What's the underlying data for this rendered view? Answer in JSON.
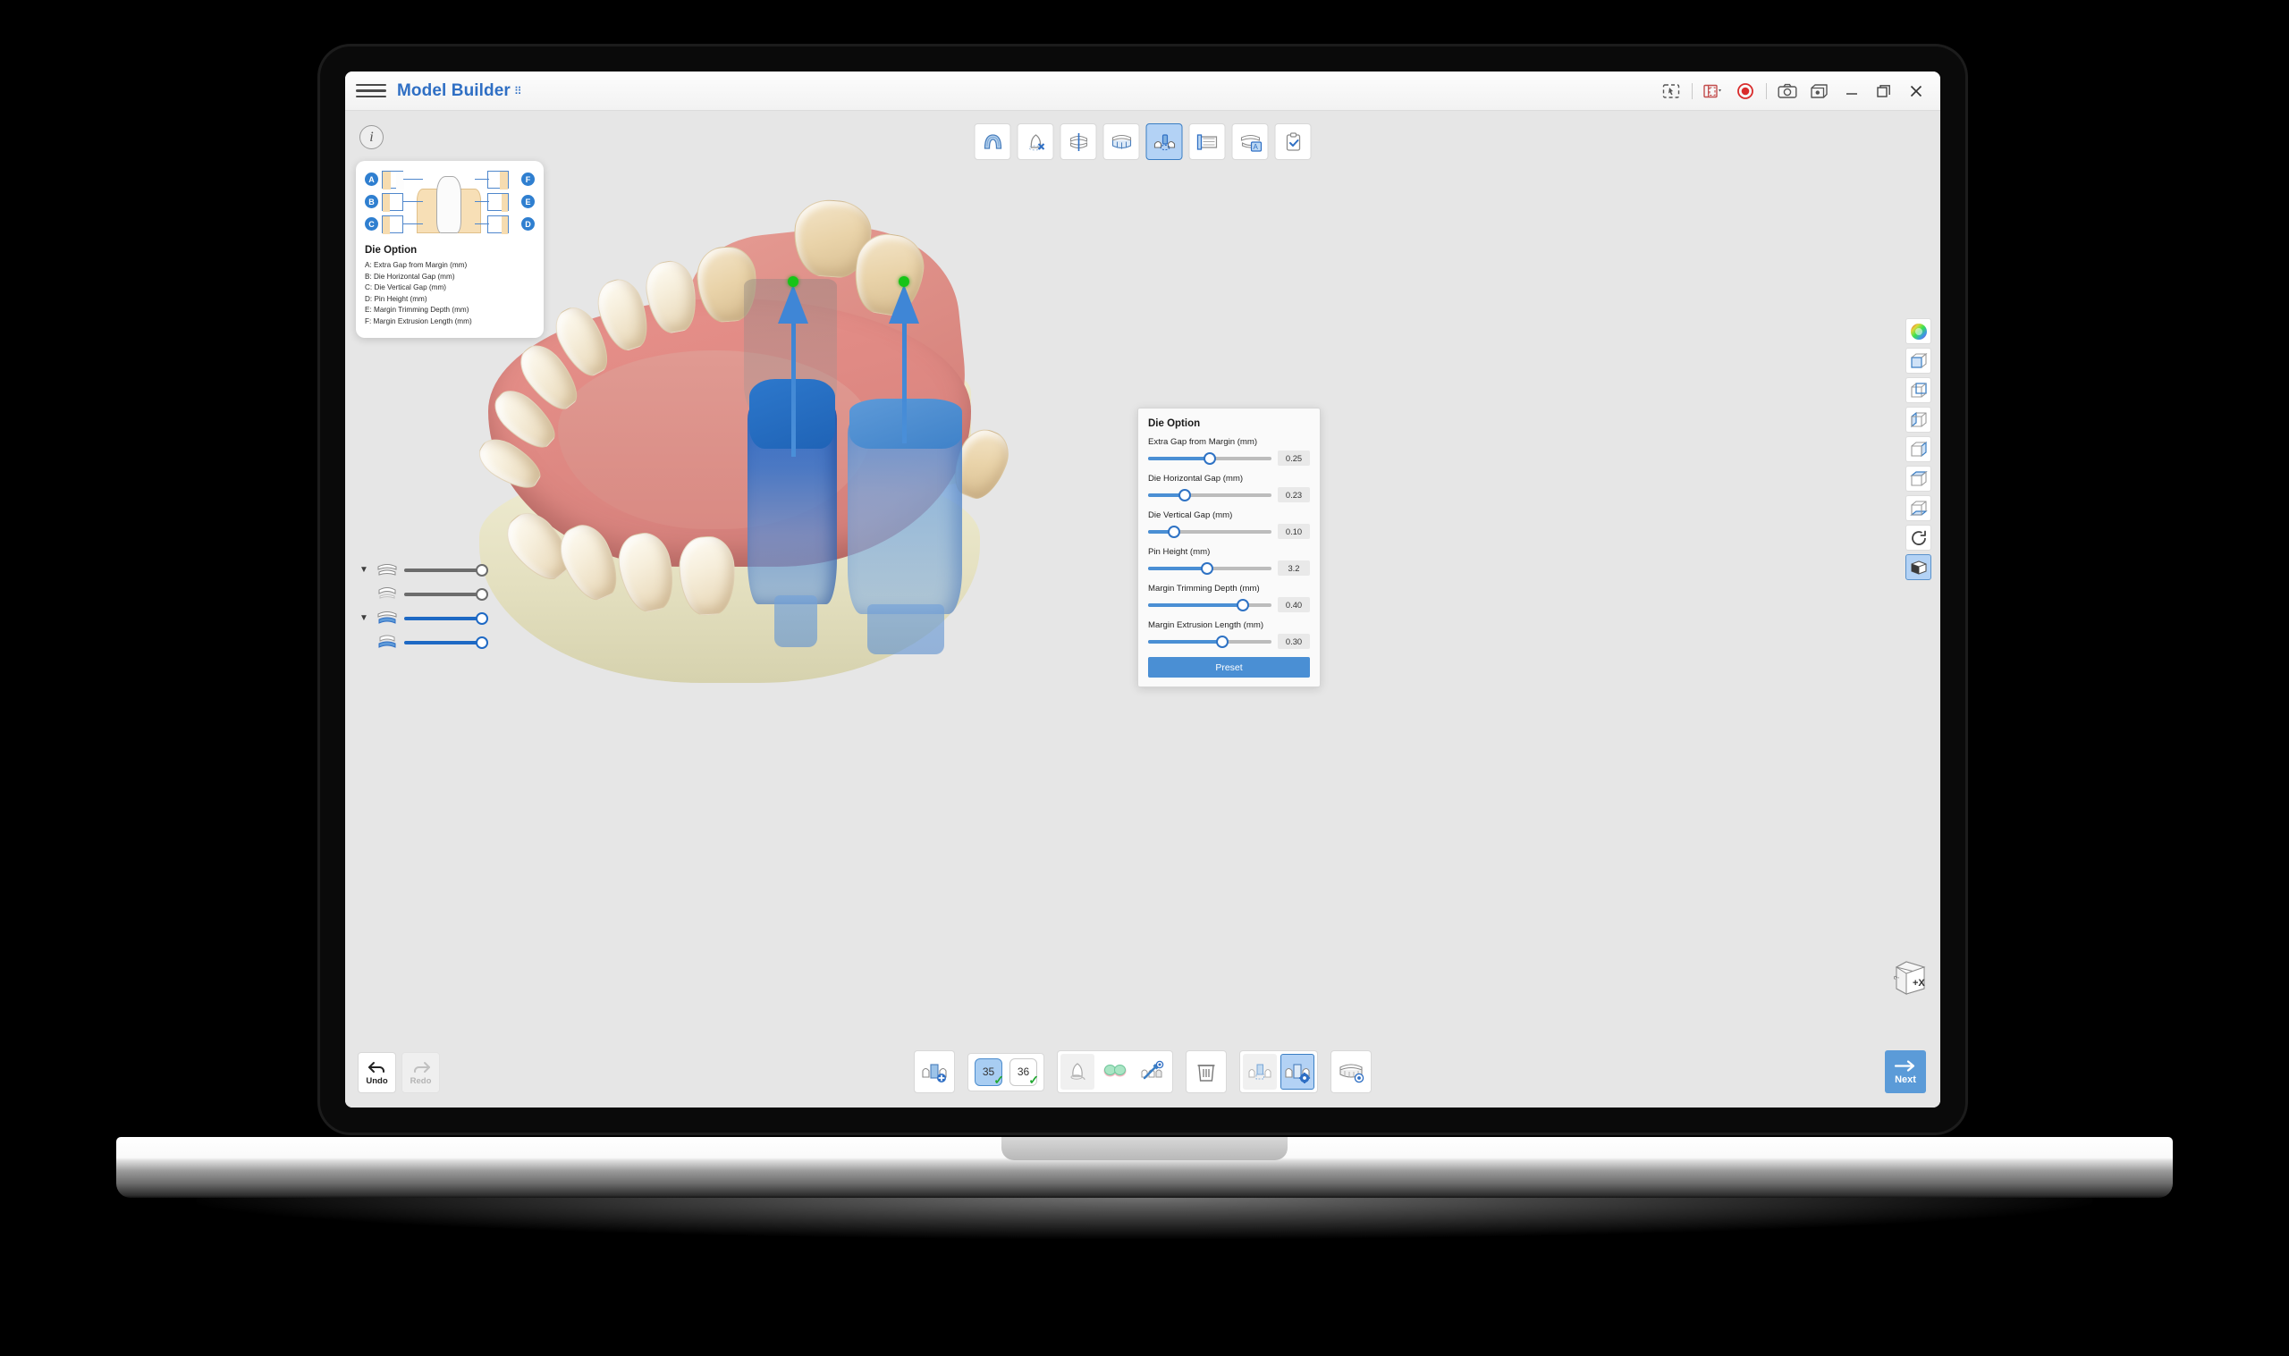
{
  "titlebar": {
    "menu_icon": "hamburger-icon",
    "app_title": "Model Builder",
    "title_superscript": "⠿",
    "controls": [
      {
        "name": "help-pointer-icon",
        "glyph": "⌸"
      },
      {
        "name": "layout-dropdown-icon",
        "glyph": "▥"
      },
      {
        "name": "record-icon",
        "glyph": "●"
      },
      {
        "name": "camera-icon",
        "glyph": "▣"
      },
      {
        "name": "snapshot-icon",
        "glyph": "▨"
      },
      {
        "name": "minimize-icon",
        "glyph": "—"
      },
      {
        "name": "maximize-icon",
        "glyph": "❐"
      },
      {
        "name": "close-icon",
        "glyph": "✕"
      }
    ]
  },
  "info_button": {
    "label": "i"
  },
  "legend": {
    "title": "Die Option",
    "badges": [
      "A",
      "B",
      "C",
      "D",
      "E",
      "F"
    ],
    "lines": [
      "A: Extra Gap from Margin (mm)",
      "B: Die Horizontal Gap (mm)",
      "C: Die Vertical Gap (mm)",
      "D: Pin Height (mm)",
      "E: Margin Trimming Depth (mm)",
      "F: Margin Extrusion Length (mm)"
    ]
  },
  "left_sliders": {
    "rows": [
      {
        "name": "opacity-upper-both-arches",
        "icon": "both-arches-icon",
        "color": "gray",
        "value": 100,
        "has_arrow": true
      },
      {
        "name": "opacity-upper-arch",
        "icon": "upper-arch-icon",
        "color": "gray",
        "value": 100,
        "has_arrow": false
      },
      {
        "name": "opacity-lower-both-arches",
        "icon": "both-arches-blue-icon",
        "color": "blue",
        "value": 100,
        "has_arrow": true
      },
      {
        "name": "opacity-lower-arch",
        "icon": "lower-arch-blue-icon",
        "color": "blue",
        "value": 100,
        "has_arrow": false
      }
    ]
  },
  "top_toolbar": {
    "buttons": [
      {
        "name": "tool-tray-base",
        "icon": "arch-tray-icon",
        "active": false
      },
      {
        "name": "tool-trim-cut",
        "icon": "cut-trim-icon",
        "active": false
      },
      {
        "name": "tool-articulate",
        "icon": "articulation-icon",
        "active": false
      },
      {
        "name": "tool-base-plate",
        "icon": "base-plate-icon",
        "active": false
      },
      {
        "name": "tool-die-option",
        "icon": "die-pin-icon",
        "active": true
      },
      {
        "name": "tool-sectioning",
        "icon": "sectioning-icon",
        "active": false
      },
      {
        "name": "tool-label-text",
        "icon": "label-text-icon",
        "active": false
      },
      {
        "name": "tool-review",
        "icon": "clipboard-check-icon",
        "active": false
      }
    ]
  },
  "bottom_toolbar": {
    "add_die_button": {
      "name": "add-die-button",
      "icon": "add-die-icon"
    },
    "tooth_numbers": [
      {
        "number": "35",
        "selected": true,
        "checked": true
      },
      {
        "number": "36",
        "selected": false,
        "checked": true
      }
    ],
    "group_two": [
      {
        "name": "single-die-button",
        "icon": "single-die-icon",
        "active": false,
        "dim": true
      },
      {
        "name": "gingiva-mask-button",
        "icon": "gingiva-mask-icon",
        "active": false,
        "dim": false
      },
      {
        "name": "margin-edit-button",
        "icon": "margin-pen-icon",
        "active": false,
        "dim": false
      }
    ],
    "delete_button": {
      "name": "delete-button",
      "icon": "trash-icon"
    },
    "group_three": [
      {
        "name": "die-preview-button",
        "icon": "die-preview-icon",
        "active": false,
        "dim": true
      },
      {
        "name": "die-settings-button",
        "icon": "die-gear-icon",
        "active": true,
        "dim": false
      }
    ],
    "show_model_button": {
      "name": "show-model-button",
      "icon": "arch-eye-icon"
    }
  },
  "undo_redo": {
    "undo": {
      "label": "Undo",
      "enabled": true
    },
    "redo": {
      "label": "Redo",
      "enabled": false
    }
  },
  "next_button": {
    "label": "Next"
  },
  "right_sidebar": {
    "buttons": [
      {
        "name": "color-wheel-button",
        "icon": "color-wheel-icon",
        "active": false
      },
      {
        "name": "view-front-button",
        "icon": "cube-front-icon",
        "active": false
      },
      {
        "name": "view-back-button",
        "icon": "cube-back-icon",
        "active": false
      },
      {
        "name": "view-left-button",
        "icon": "cube-left-icon",
        "active": false
      },
      {
        "name": "view-right-button",
        "icon": "cube-right-icon",
        "active": false
      },
      {
        "name": "view-top-button",
        "icon": "cube-top-icon",
        "active": false
      },
      {
        "name": "view-bottom-button",
        "icon": "cube-bottom-icon",
        "active": false
      },
      {
        "name": "reset-view-button",
        "icon": "rotate-refresh-icon",
        "active": false
      },
      {
        "name": "perspective-button",
        "icon": "cube-solid-icon",
        "active": true
      }
    ]
  },
  "nav_cube": {
    "face_label": "+X"
  },
  "die_panel": {
    "title": "Die Option",
    "sliders": [
      {
        "label": "Extra Gap from Margin (mm)",
        "value": "0.25",
        "percent": 50
      },
      {
        "label": "Die Horizontal Gap (mm)",
        "value": "0.23",
        "percent": 30
      },
      {
        "label": "Die Vertical Gap (mm)",
        "value": "0.10",
        "percent": 21
      },
      {
        "label": "Pin Height (mm)",
        "value": "3.2",
        "percent": 48
      },
      {
        "label": "Margin Trimming Depth (mm)",
        "value": "0.40",
        "percent": 77
      },
      {
        "label": "Margin Extrusion Length (mm)",
        "value": "0.30",
        "percent": 60
      }
    ],
    "preset_button": "Preset"
  },
  "colors": {
    "accent_blue": "#2f6fc4",
    "slider_blue": "#4a8fd4",
    "active_bg": "#b3d2f5",
    "record_red": "#d92b2b",
    "check_green": "#22a832",
    "pin_green": "#17c417",
    "gum_pink": "#e0897f",
    "base_cream": "#e8e3c2",
    "die_blue": "#2d78cc"
  }
}
